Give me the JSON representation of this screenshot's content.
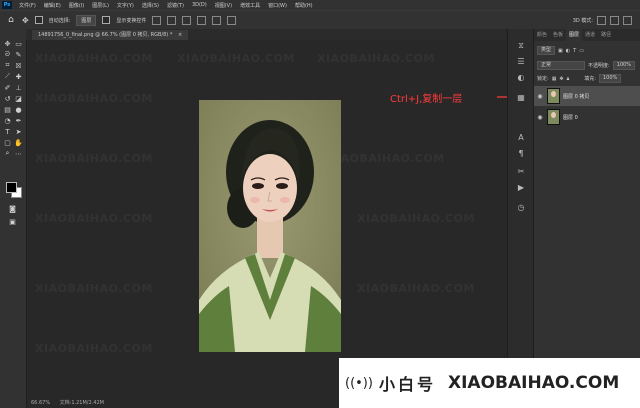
{
  "menu": {
    "logo": "Ps",
    "items": [
      "文件(F)",
      "编辑(E)",
      "图像(I)",
      "图层(L)",
      "文字(Y)",
      "选择(S)",
      "滤镜(T)",
      "3D(D)",
      "视图(V)",
      "增效工具",
      "窗口(W)",
      "帮助(H)"
    ]
  },
  "options": {
    "auto_select_label": "自动选择:",
    "auto_select_value": "图层",
    "show_transform_label": "显示变换控件",
    "mode_3d_label": "3D 模式:"
  },
  "document": {
    "tab_title": "14891756_0_final.png @ 66.7% (图层 0 拷贝, RGB/8) *",
    "close_glyph": "×"
  },
  "annotation": {
    "text": "Ctrl+J,复制一层",
    "color": "#ff3b3b"
  },
  "layers_panel": {
    "tabs": [
      "颜色",
      "色板",
      "图层",
      "通道",
      "路径"
    ],
    "active_tab": "图层",
    "kind_label": "类型",
    "blend_mode": "正常",
    "opacity_label": "不透明度:",
    "opacity_value": "100%",
    "lock_label": "锁定:",
    "fill_label": "填充:",
    "fill_value": "100%",
    "layers": [
      {
        "name": "图层 0 拷贝",
        "selected": true
      },
      {
        "name": "图层 0",
        "selected": false
      }
    ]
  },
  "status": {
    "zoom": "66.67%",
    "doc_size": "文档:1.21M/2.42M"
  },
  "watermark": {
    "text": "XIAOBAIHAO.COM"
  },
  "banner": {
    "logo_glyph": "((•))",
    "cn_text": "小白号",
    "en_text": "XIAOBAIHAO.COM"
  },
  "colors": {
    "foreground": "#000000",
    "background": "#ffffff",
    "canvas_bg": "#8b8c62",
    "robe_green": "#5f7f3c"
  },
  "icons": {
    "toolbar": [
      "move-tool-icon",
      "marquee-tool-icon",
      "lasso-tool-icon",
      "quick-select-icon",
      "crop-tool-icon",
      "frame-tool-icon",
      "eyedropper-icon",
      "spot-healing-icon",
      "brush-tool-icon",
      "clone-stamp-icon",
      "history-brush-icon",
      "eraser-icon",
      "gradient-icon",
      "blur-icon",
      "dodge-icon",
      "pen-tool-icon",
      "type-tool-icon",
      "path-select-icon",
      "rectangle-tool-icon",
      "hand-tool-icon",
      "zoom-tool-icon"
    ],
    "dock": [
      "history-icon",
      "properties-icon",
      "adjustments-icon",
      "libraries-icon",
      "character-icon",
      "paragraph-icon",
      "brush-settings-icon",
      "actions-icon"
    ]
  }
}
